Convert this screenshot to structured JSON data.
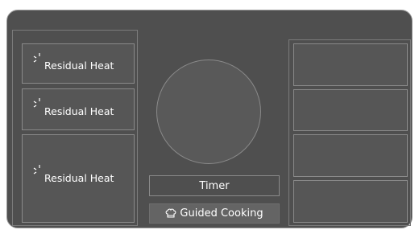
{
  "cooktop": {
    "left_zones": [
      {
        "label": "Residual Heat"
      },
      {
        "label": "Residual Heat"
      },
      {
        "label": "Residual Heat"
      }
    ],
    "timer_label": "Timer",
    "guided_cooking_label": "Guided Cooking",
    "icons": {
      "residual_heat": "residual-heat-icon",
      "guided_cooking": "chef-hat-icon"
    },
    "colors": {
      "panel": "#4f4f4f",
      "zone": "#565656",
      "border": "#8a8a8a",
      "text": "#ffffff"
    }
  }
}
